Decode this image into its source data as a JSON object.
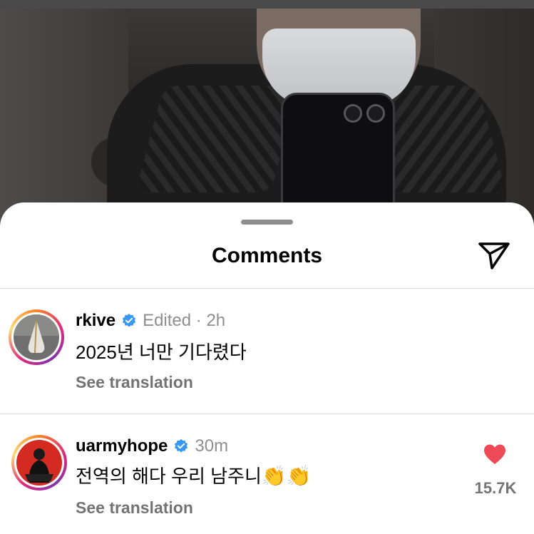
{
  "sheet": {
    "title": "Comments"
  },
  "comments": [
    {
      "username": "rkive",
      "verified": true,
      "meta": "Edited · 2h",
      "text": "2025년 너만 기다렸다",
      "see_translation": "See translation"
    },
    {
      "username": "uarmyhope",
      "verified": true,
      "meta": "30m",
      "text": "전역의 해다 우리 남주니",
      "emoji": "👏👏",
      "see_translation": "See translation",
      "liked": true,
      "like_count": "15.7K"
    }
  ],
  "colors": {
    "like": "#ed4956",
    "verified": "#3897f0",
    "meta": "#8e8e8e",
    "secondary": "#737373"
  },
  "icons": {
    "share": "paper-plane-icon",
    "verified": "verified-badge-icon",
    "like": "heart-filled-icon",
    "handle": "drag-handle"
  }
}
